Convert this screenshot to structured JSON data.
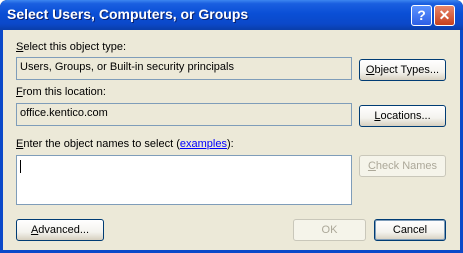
{
  "window": {
    "title": "Select Users, Computers, or Groups",
    "help_glyph": "?",
    "close_glyph": "✕"
  },
  "object_type": {
    "label_key": "S",
    "label_rest": "elect this object type:",
    "value": "Users, Groups, or Built-in security principals",
    "button_key": "O",
    "button_rest": "bject Types..."
  },
  "location": {
    "label_key": "F",
    "label_rest": "rom this location:",
    "value": "office.kentico.com",
    "button_key": "L",
    "button_rest": "ocations..."
  },
  "names": {
    "label_key": "E",
    "label_rest": "nter the object names to select (",
    "link": "examples",
    "label_end": "):",
    "value": "",
    "check_key": "C",
    "check_rest": "heck Names"
  },
  "footer": {
    "advanced_key": "A",
    "advanced_rest": "dvanced...",
    "ok": "OK",
    "cancel": "Cancel"
  },
  "colors": {
    "titlebar": "#0a4fd6",
    "client": "#ece9d8",
    "link": "#0000ff"
  }
}
